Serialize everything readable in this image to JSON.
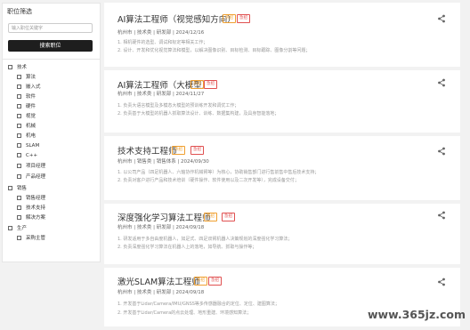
{
  "sidebar": {
    "title": "职位筛选",
    "search_placeholder": "输入职位关键字",
    "search_button": "搜索职位",
    "tree": [
      {
        "label": "技术",
        "level": 0
      },
      {
        "label": "算法",
        "level": 1
      },
      {
        "label": "嵌入式",
        "level": 1
      },
      {
        "label": "软件",
        "level": 1
      },
      {
        "label": "硬件",
        "level": 1
      },
      {
        "label": "视觉",
        "level": 1
      },
      {
        "label": "机械",
        "level": 1
      },
      {
        "label": "机电",
        "level": 1
      },
      {
        "label": "SLAM",
        "level": 1
      },
      {
        "label": "C++",
        "level": 1
      },
      {
        "label": "项目经理",
        "level": 1
      },
      {
        "label": "产品经理",
        "level": 1
      },
      {
        "label": "销售",
        "level": 0
      },
      {
        "label": "销售经理",
        "level": 1
      },
      {
        "label": "技术支持",
        "level": 1
      },
      {
        "label": "解决方案",
        "level": 1
      },
      {
        "label": "生产",
        "level": 0
      },
      {
        "label": "采购主管",
        "level": 1
      }
    ]
  },
  "jobs": [
    {
      "title": "AI算法工程师（视觉感知方向）",
      "tags": [
        "热招",
        "急招"
      ],
      "meta": "杭州市 | 技术类 | 研发部 | 2024/12/16",
      "desc": [
        "1. 相机硬件的选型、调试和标定等相关工作；",
        "2. 设计、开发和优化视觉算法和模型，以解决图像识别、目标检测、目标跟踪、图像分割等问题；"
      ]
    },
    {
      "title": "AI算法工程师（大模型）",
      "tags": [
        "热招",
        "急招"
      ],
      "meta": "杭州市 | 技术类 | 研发部 | 2024/11/27",
      "desc": [
        "1. 负责大语言模型及多模态大模型的预训练开发和调优工作；",
        "2. 负责基于大模型的机器人抓取算法设计、训练、数据集构建，及具身智能落地；"
      ]
    },
    {
      "title": "技术支持工程师",
      "tags": [
        "热招",
        "急招"
      ],
      "meta": "杭州市 | 销售类 | 销售体系 | 2024/09/30",
      "desc": [
        "1. 以公司产品（四足机器人、六轴协作机械臂等）为核心，协助销售部门进行售前售中售后技术支持；",
        "2. 负责对客户进行产品和技术培训（硬件操作、软件使用以及二次开发等），完成设备交付；"
      ]
    },
    {
      "title": "深度强化学习算法工程师",
      "tags": [
        "热招",
        "急招"
      ],
      "meta": "杭州市 | 技术类 | 研发部 | 2024/09/18",
      "desc": [
        "1. 研发适用于多自由度机器人，如足式、四足双臂机器人决策规划的深度强化学习算法；",
        "2. 负责深度强化学习算法在机器人上的落地，如导航、抓取与操作等；"
      ]
    },
    {
      "title": "激光SLAM算法工程师",
      "tags": [
        "热招",
        "急招"
      ],
      "meta": "杭州市 | 技术类 | 研发部 | 2024/09/18",
      "desc": [
        "1. 开发基于Lidar/Camera/IMU/GNSS等多传感器融合的定位、定位、建图算法；",
        "2. 开发基于Lidar/Camera的点云处理、地形重建、环境感知算法；"
      ]
    }
  ],
  "watermark": "www.365jz.com",
  "colors": {
    "tag_hot": "#f0a030",
    "tag_recruit": "#e05050",
    "button_bg": "#1e1e1e"
  },
  "icons": {
    "share": "share-icon",
    "checkbox": "checkbox-icon"
  }
}
